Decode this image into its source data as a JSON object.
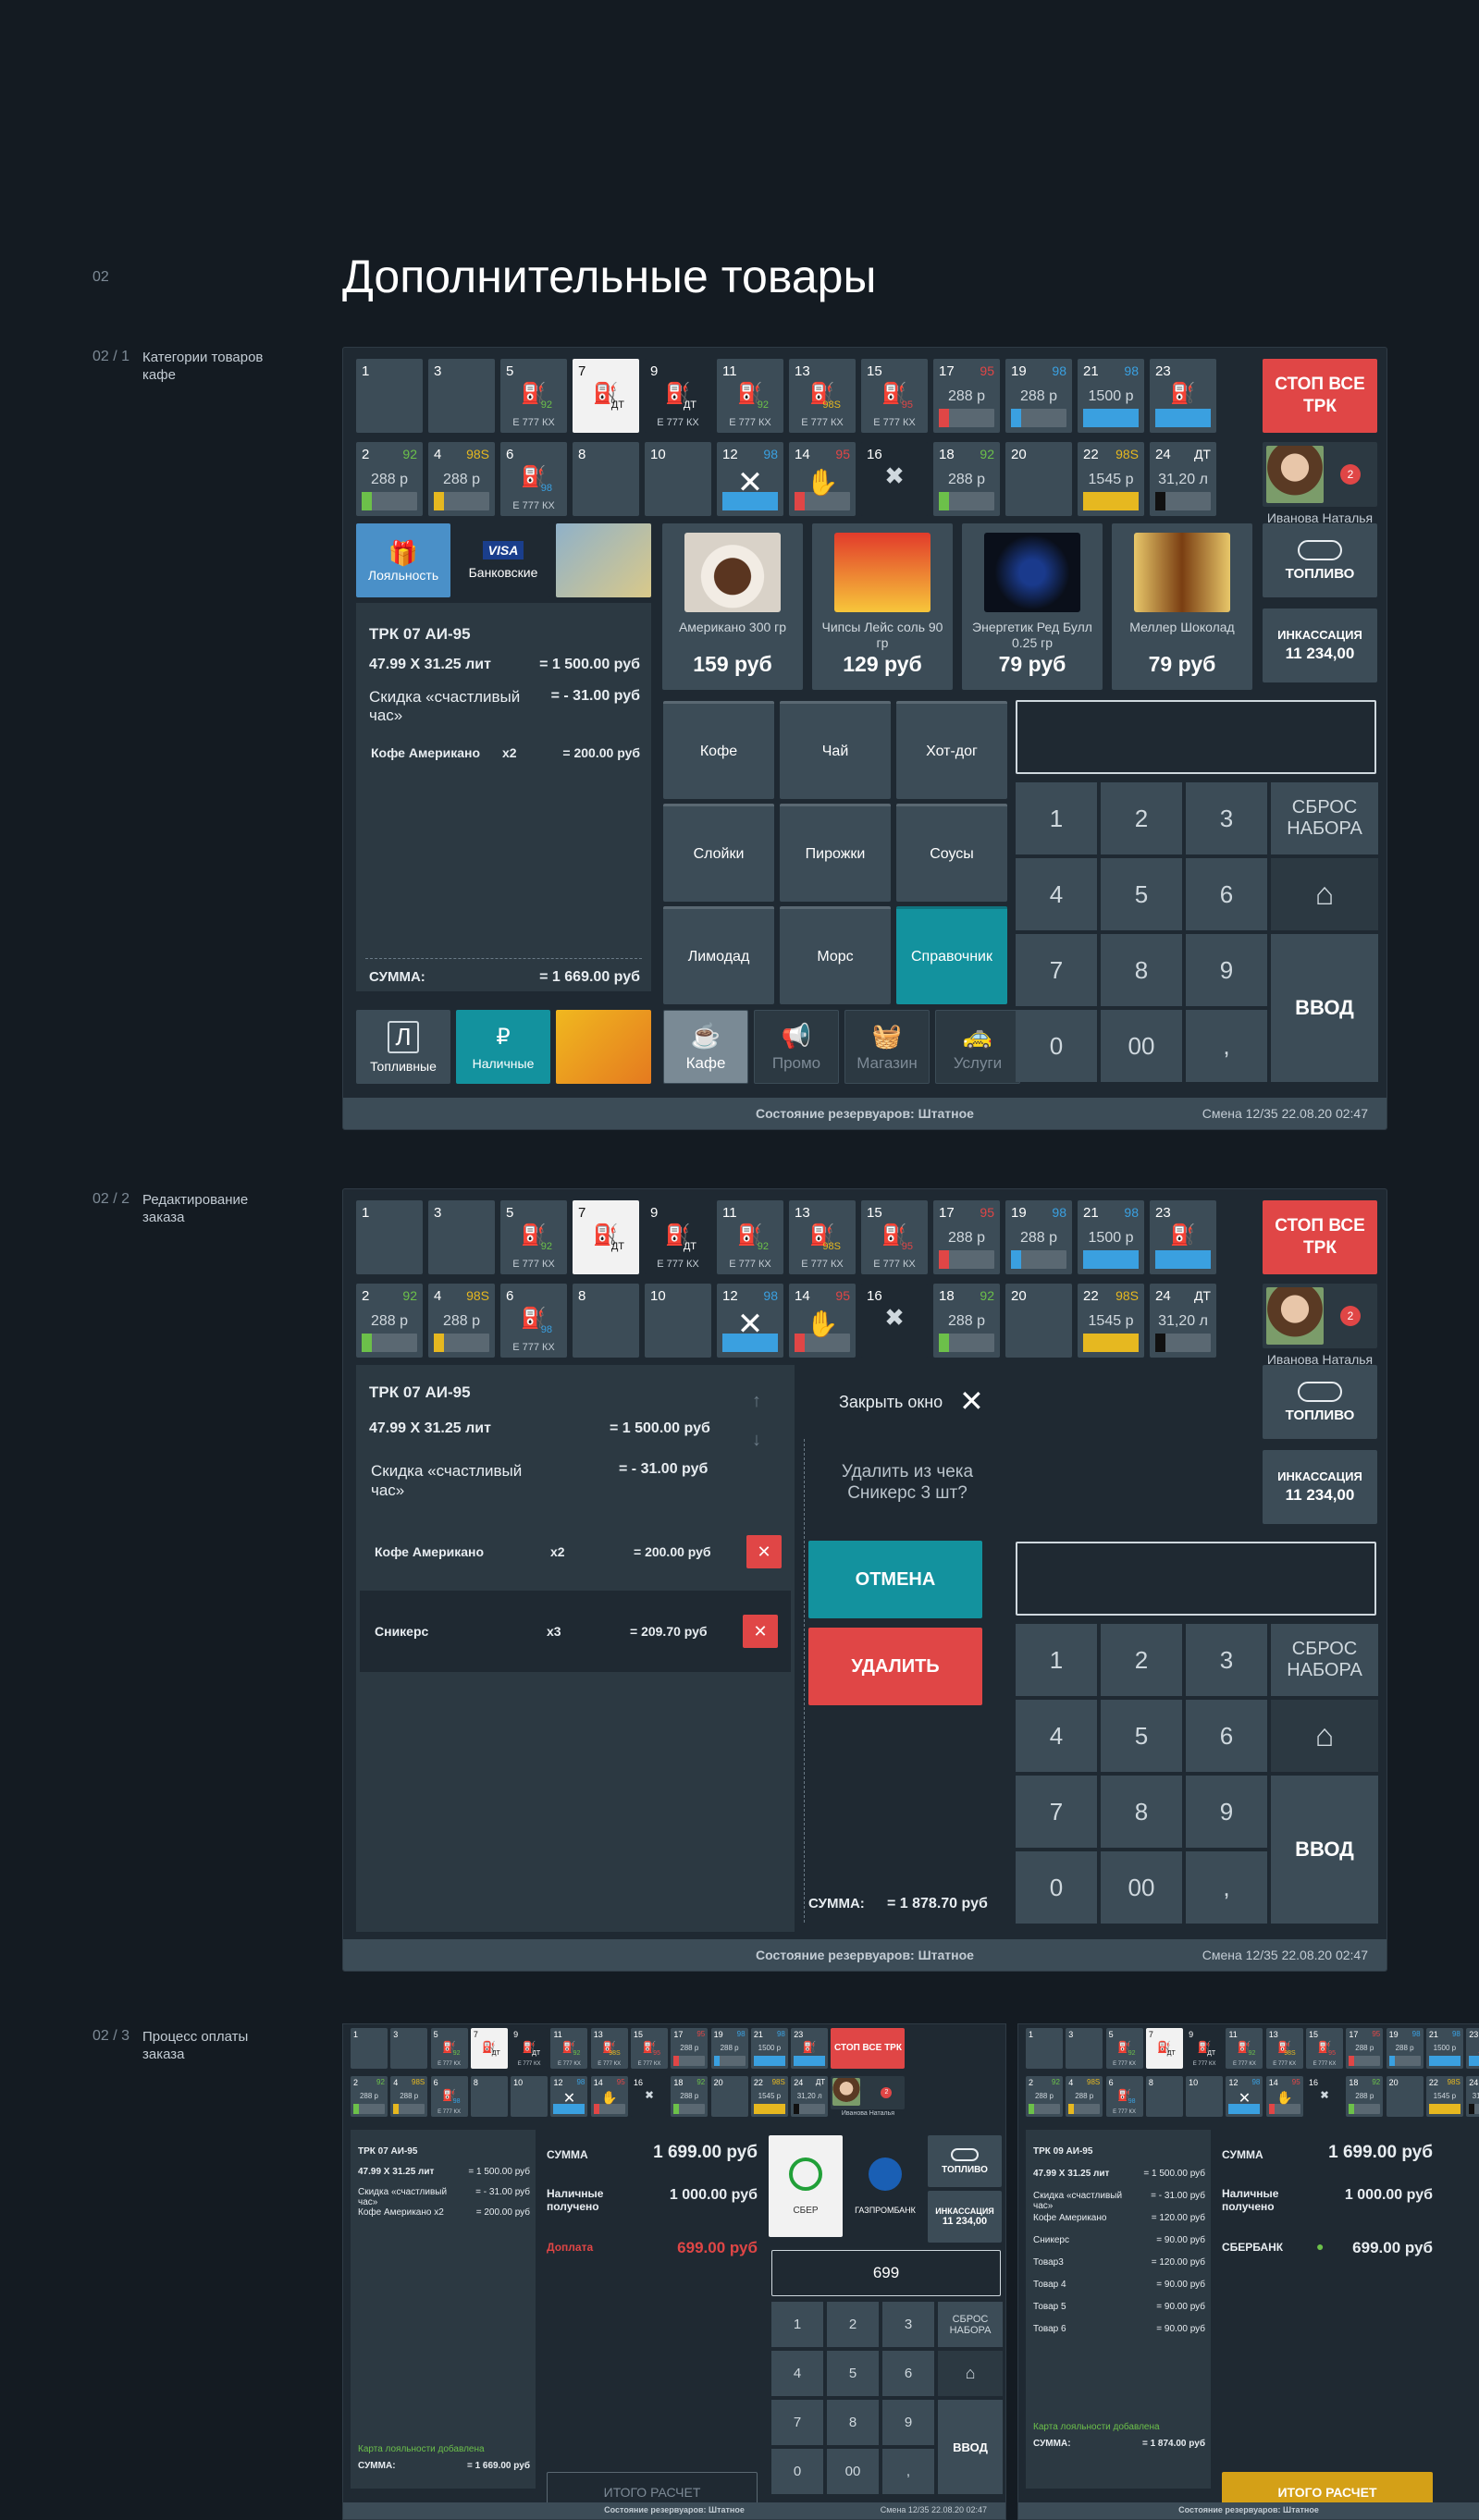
{
  "section_num": "02",
  "title": "Дополнительные товары",
  "sections": [
    {
      "num": "02 / 1",
      "label": "Категории товаров кафе"
    },
    {
      "num": "02 / 2",
      "label": "Редактирование заказа"
    },
    {
      "num": "02 / 3",
      "label": "Процесс оплаты заказа"
    }
  ],
  "pumps": {
    "row1": [
      {
        "n": "1"
      },
      {
        "n": "3"
      },
      {
        "n": "5",
        "grade": "92",
        "plate": "Е 777 КХ"
      },
      {
        "n": "7",
        "grade": "ДТ"
      },
      {
        "n": "9",
        "grade": "ДТ",
        "plate": "Е 777 КХ"
      },
      {
        "n": "11",
        "grade": "92",
        "plate": "Е 777 КХ"
      },
      {
        "n": "13",
        "grade": "98S",
        "plate": "Е 777 КХ"
      },
      {
        "n": "15",
        "grade": "95",
        "plate": "Е 777 КХ"
      },
      {
        "n": "17",
        "g": "95",
        "price": "288 р"
      },
      {
        "n": "19",
        "g": "98",
        "price": "288 р"
      },
      {
        "n": "21",
        "g": "98",
        "price": "1500 р"
      },
      {
        "n": "23"
      }
    ],
    "row2": [
      {
        "n": "2",
        "g": "92",
        "price": "288 р"
      },
      {
        "n": "4",
        "g": "98S",
        "price": "288 р"
      },
      {
        "n": "6",
        "grade": "98",
        "plate": "Е 777 КХ"
      },
      {
        "n": "8"
      },
      {
        "n": "10"
      },
      {
        "n": "12",
        "g": "98"
      },
      {
        "n": "14",
        "g": "95"
      },
      {
        "n": "16"
      },
      {
        "n": "18",
        "g": "92",
        "price": "288 р"
      },
      {
        "n": "20"
      },
      {
        "n": "22",
        "g": "98S",
        "price": "1545 р"
      },
      {
        "n": "24",
        "g": "ДТ",
        "price": "31,20 л"
      }
    ],
    "stop": "СТОП ВСЕ ТРК",
    "operator": "Иванова Наталья",
    "badge": "2"
  },
  "s1": {
    "payment_tabs": [
      "Лояльность",
      "Банковские"
    ],
    "receipt": {
      "trk": "ТРК 07  АИ-95",
      "line1": "47.99 X 31.25 лит",
      "line1v": "= 1 500.00 руб",
      "disc": "Скидка «счастливый час»",
      "discv": "= - 31.00  руб",
      "item": "Кофе Американо",
      "qty": "x2",
      "itemv": "= 200.00 руб",
      "sum": "СУММА:",
      "sumv": "= 1 669.00  руб"
    },
    "bottom_tabs": [
      "Топливные",
      "Наличные"
    ],
    "products": [
      {
        "name": "Американо 300 гр",
        "price": "159 руб"
      },
      {
        "name": "Чипсы Лейс соль 90 гр",
        "price": "129 руб"
      },
      {
        "name": "Энергетик Ред Булл  0.25 гр",
        "price": "79 руб"
      },
      {
        "name": "Меллер Шоколад",
        "price": "79 руб"
      }
    ],
    "categories": [
      "Кофе",
      "Чай",
      "Хот-дог",
      "Слойки",
      "Пирожки",
      "Соусы",
      "Лимодад",
      "Морс",
      "Справочник"
    ],
    "modes": [
      "Кафе",
      "Промо",
      "Магазин",
      "Услуги"
    ],
    "fuel": "ТОПЛИВО",
    "cash_title": "ИНКАССАЦИЯ",
    "cash_value": "11 234,00",
    "keys": [
      "1",
      "2",
      "3",
      "4",
      "5",
      "6",
      "7",
      "8",
      "9",
      "0",
      "00",
      ","
    ],
    "reset": "СБРОС НАБОРА",
    "enter": "ВВОД",
    "status": "Состояние резервуаров: Штатное",
    "shift": "Смена 12/35    22.08.20 02:47"
  },
  "s2": {
    "trk": "ТРК 07  АИ-95",
    "line1": "47.99 X 31.25 лит",
    "line1v": "= 1 500.00 руб",
    "disc": "Скидка «счастливый час»",
    "discv": "= - 31.00  руб",
    "items": [
      {
        "name": "Кофе Американо",
        "qty": "x2",
        "v": "= 200.00 руб"
      },
      {
        "name": "Сникерс",
        "qty": "x3",
        "v": "= 209.70 руб"
      }
    ],
    "close": "Закрыть окно",
    "question": "Удалить из чека Сникерс 3 шт?",
    "cancel": "ОТМЕНА",
    "delete": "УДАЛИТЬ",
    "sum": "СУММА:",
    "sumv": "= 1 878.70  руб"
  },
  "s3": {
    "a": {
      "sum": "СУММА",
      "sumv": "1 699.00 руб",
      "cash": "Наличные получено",
      "cashv": "1 000.00 руб",
      "extra": "Доплата",
      "extrav": "699.00 руб",
      "input": "699",
      "banks": [
        "СБЕР",
        "ГАЗПРОМБАНК"
      ],
      "total": "ИТОГО РАСЧЕТ",
      "loyal": "Карта лояльности  добавлена",
      "receipt": [
        [
          "ТРК 07  АИ-95",
          ""
        ],
        [
          "47.99 X 31.25 лит",
          "= 1 500.00 руб"
        ],
        [
          "Скидка «счастливый час»",
          "= - 31.00  руб"
        ],
        [
          "Кофе Американо   x2",
          "= 200.00 руб"
        ]
      ],
      "rsum": "= 1 669.00 руб"
    },
    "b": {
      "sum": "СУММА",
      "sumv": "1 699.00 руб",
      "cash": "Наличные получено",
      "cashv": "1 000.00 руб",
      "bank": "СБЕРБАНК",
      "bankv": "699.00 руб",
      "total": "ИТОГО РАСЧЕТ",
      "loyal": "Карта лояльности  добавлена",
      "receipt": [
        [
          "ТРК 09  АИ-95",
          ""
        ],
        [
          "47.99 X 31.25 лит",
          "= 1 500.00 руб"
        ],
        [
          "Скидка «счастливый час»",
          "= - 31.00 руб"
        ],
        [
          "Кофе Американо",
          "= 120.00 руб"
        ],
        [
          "Сникерс",
          "= 90.00 руб"
        ],
        [
          "Товар3",
          "= 120.00 руб"
        ],
        [
          "Товар 4",
          "= 90.00 руб"
        ],
        [
          "Товар 5",
          "= 90.00 руб"
        ],
        [
          "Товар 6",
          "= 90.00 руб"
        ]
      ],
      "rsum": "= 1 874.00 руб"
    },
    "small_labels": [
      "Лояльность",
      "Банковские",
      "Топливные",
      "Наличные"
    ],
    "status": "Состояние резервуаров: Штатное",
    "shift": "Смена 12/35    22.08.20 02:47"
  },
  "colors": {
    "bg": "#141b22",
    "tile": "#3c4c57",
    "teal": "#13929e",
    "red": "#e04646",
    "g92": "#6cc04a",
    "g95": "#e04646",
    "g98": "#3aa0e0",
    "g98s": "#e6b820"
  }
}
